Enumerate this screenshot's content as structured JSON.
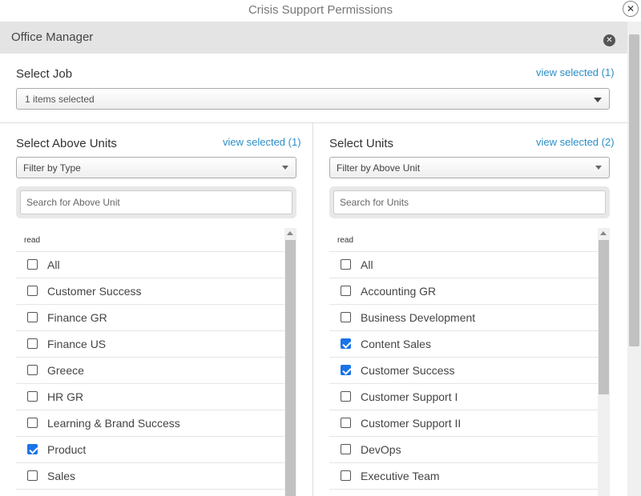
{
  "window": {
    "title": "Crisis Support Permissions",
    "close_symbol": "✕"
  },
  "section": {
    "title": "Office Manager",
    "close_symbol": "✕"
  },
  "job": {
    "label": "Select Job",
    "view_selected": "view selected (1)",
    "selected_text": "1 items selected"
  },
  "above_units": {
    "title": "Select Above Units",
    "view_selected": "view selected (1)",
    "filter_value": "Filter by Type",
    "search_placeholder": "Search for Above Unit",
    "list_header": "read",
    "items": [
      {
        "label": "All",
        "checked": false
      },
      {
        "label": "Customer Success",
        "checked": false
      },
      {
        "label": "Finance GR",
        "checked": false
      },
      {
        "label": "Finance US",
        "checked": false
      },
      {
        "label": "Greece",
        "checked": false
      },
      {
        "label": "HR GR",
        "checked": false
      },
      {
        "label": "Learning & Brand Success",
        "checked": false
      },
      {
        "label": "Product",
        "checked": true
      },
      {
        "label": "Sales",
        "checked": false
      }
    ]
  },
  "units": {
    "title": "Select Units",
    "view_selected": "view selected (2)",
    "filter_value": "Filter by Above Unit",
    "search_placeholder": "Search for Units",
    "list_header": "read",
    "items": [
      {
        "label": "All",
        "checked": false
      },
      {
        "label": "Accounting GR",
        "checked": false
      },
      {
        "label": "Business Development",
        "checked": false
      },
      {
        "label": "Content Sales",
        "checked": true
      },
      {
        "label": "Customer Success",
        "checked": true
      },
      {
        "label": "Customer Support I",
        "checked": false
      },
      {
        "label": "Customer Support II",
        "checked": false
      },
      {
        "label": "DevOps",
        "checked": false
      },
      {
        "label": "Executive Team",
        "checked": false
      }
    ]
  },
  "colors": {
    "accent": "#2a8ec8",
    "checkbox_checked": "#1a73e8",
    "header_bg": "#e4e4e4"
  }
}
